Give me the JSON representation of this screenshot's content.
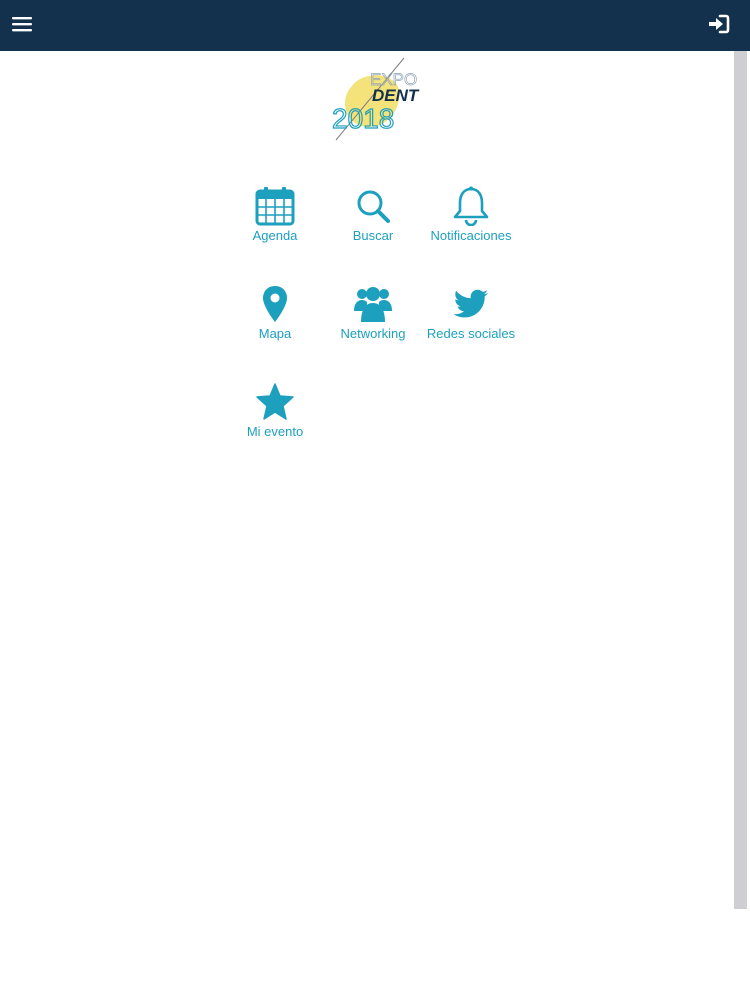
{
  "header": {
    "background": "#13304d",
    "menu_icon": "hamburger-menu-icon",
    "login_icon": "sign-in-icon"
  },
  "logo": {
    "line1": "EXPO",
    "line2": "DENT",
    "line3": "2018"
  },
  "accent_color": "#1d9fbe",
  "menu": {
    "items": [
      {
        "label": "Agenda",
        "icon": "calendar-icon"
      },
      {
        "label": "Buscar",
        "icon": "search-icon"
      },
      {
        "label": "Notificaciones",
        "icon": "bell-icon"
      },
      {
        "label": "Mapa",
        "icon": "map-marker-icon"
      },
      {
        "label": "Networking",
        "icon": "users-icon"
      },
      {
        "label": "Redes sociales",
        "icon": "twitter-icon"
      },
      {
        "label": "Mi evento",
        "icon": "star-icon"
      }
    ]
  }
}
